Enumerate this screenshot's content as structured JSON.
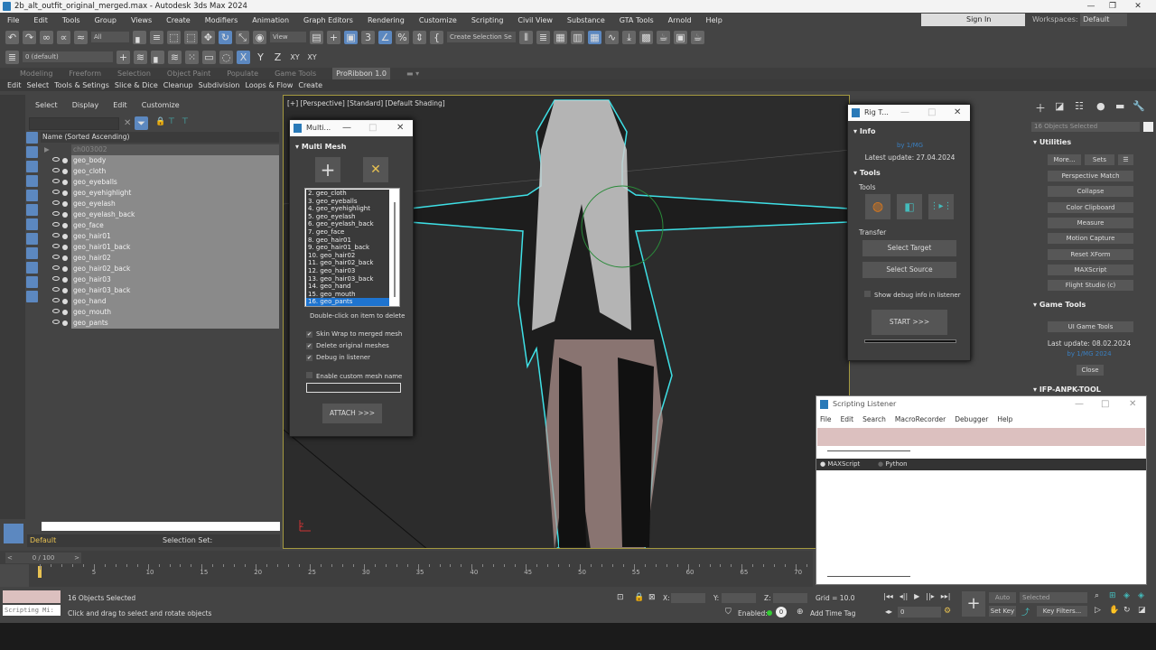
{
  "window": {
    "title": "2b_alt_outfit_original_merged.max - Autodesk 3ds Max 2024",
    "min": "—",
    "max": "❐",
    "close": "✕"
  },
  "menu": [
    "File",
    "Edit",
    "Tools",
    "Group",
    "Views",
    "Create",
    "Modifiers",
    "Animation",
    "Graph Editors",
    "Rendering",
    "Customize",
    "Scripting",
    "Civil View",
    "Substance",
    "GTA Tools",
    "Arnold",
    "Help"
  ],
  "signin": "Sign In",
  "workspaces": {
    "label": "Workspaces:",
    "value": "Default"
  },
  "toolbar": {
    "filter": "All",
    "refcoord": "View",
    "selection_set": "Create Selection Se",
    "layer": "0 (default)",
    "axes": [
      "X",
      "Y",
      "Z",
      "XY",
      "XY"
    ]
  },
  "ribbon_tabs": [
    {
      "label": "Modeling"
    },
    {
      "label": "Freeform"
    },
    {
      "label": "Selection"
    },
    {
      "label": "Object Paint"
    },
    {
      "label": "Populate"
    },
    {
      "label": "Game Tools"
    },
    {
      "label": "ProRibbon 1.0",
      "active": true
    }
  ],
  "sub_ribbon": [
    "Edit",
    "Select",
    "Tools & Setings",
    "Slice & Dice",
    "Cleanup",
    "Subdivision",
    "Loops & Flow",
    "Create"
  ],
  "explorer": {
    "menu": [
      "Select",
      "Display",
      "Edit",
      "Customize"
    ],
    "header": "Name (Sorted Ascending)",
    "parent": "ch003002",
    "items": [
      "geo_body",
      "geo_cloth",
      "geo_eyeballs",
      "geo_eyehighlight",
      "geo_eyelash",
      "geo_eyelash_back",
      "geo_face",
      "geo_hair01",
      "geo_hair01_back",
      "geo_hair02",
      "geo_hair02_back",
      "geo_hair03",
      "geo_hair03_back",
      "geo_hand",
      "geo_mouth",
      "geo_pants"
    ],
    "layer": "Default",
    "selection_set": "Selection Set:"
  },
  "viewport": {
    "label": "[+] [Perspective] [Standard] [Default Shading]"
  },
  "multimesh": {
    "title": "Multi...",
    "section": "Multi Mesh",
    "list": [
      "2. geo_cloth",
      "3. geo_eyeballs",
      "4. geo_eyehighlight",
      "5. geo_eyelash",
      "6. geo_eyelash_back",
      "7. geo_face",
      "8. geo_hair01",
      "9. geo_hair01_back",
      "10. geo_hair02",
      "11. geo_hair02_back",
      "12. geo_hair03",
      "13. geo_hair03_back",
      "14. geo_hand",
      "15. geo_mouth",
      "16. geo_pants"
    ],
    "hint": "Double-click on item to delete",
    "options": [
      "Skin Wrap to merged mesh",
      "Delete original meshes",
      "Debug in listener"
    ],
    "custom_name": "Enable custom mesh name",
    "attach": "ATTACH >>>"
  },
  "rigtools": {
    "title": "Rig T...",
    "info": "Info",
    "link": "by 1/MG",
    "update": "Latest update: 27.04.2024",
    "tools": "Tools",
    "tools_group": "Tools",
    "transfer": "Transfer",
    "select_target": "Select Target",
    "select_source": "Select Source",
    "debug": "Show debug info in listener",
    "start": "START >>>"
  },
  "cmdpanel": {
    "selected": "16 Objects Selected",
    "utilities": "Utilities",
    "more": "More...",
    "sets": "Sets",
    "buttons": [
      "Perspective Match",
      "Collapse",
      "Color Clipboard",
      "Measure",
      "Motion Capture",
      "Reset XForm",
      "MAXScript",
      "Flight Studio (c)"
    ],
    "game_tools": "Game Tools",
    "ui_game_tools": "UI Game Tools",
    "last_update": "Last update: 08.02.2024",
    "link": "by 1/MG 2024",
    "close": "Close",
    "ifp": "IFP-ANPK-TOOL"
  },
  "listener": {
    "title": "Scripting Listener",
    "menu": [
      "File",
      "Edit",
      "Search",
      "MacroRecorder",
      "Debugger",
      "Help"
    ],
    "maxscript": "MAXScript",
    "python": "Python"
  },
  "timeline": {
    "frame": "0 / 100",
    "ticks": [
      "0",
      "5",
      "10",
      "15",
      "20",
      "25",
      "30",
      "35",
      "40",
      "45",
      "50",
      "55",
      "60",
      "65",
      "70"
    ]
  },
  "status": {
    "selected": "16 Objects Selected",
    "prompt": "Click and drag to select and rotate objects",
    "mini": "Scripting Mi:",
    "x": "X:",
    "y": "Y:",
    "z": "Z:",
    "grid": "Grid = 10.0",
    "enabled": "Enabled:",
    "add_time_tag": "Add Time Tag",
    "auto_key": "Auto Key",
    "set_key": "Set Key",
    "key_mode": "Selected",
    "key_filters": "Key Filters...",
    "current_frame": "0"
  }
}
